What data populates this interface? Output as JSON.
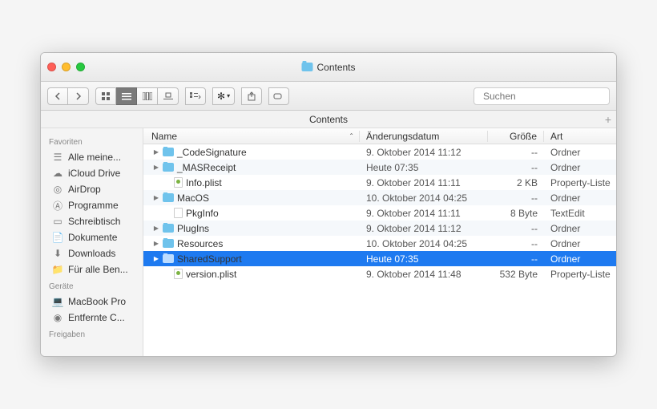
{
  "window": {
    "title": "Contents"
  },
  "toolbar": {
    "search_placeholder": "Suchen"
  },
  "pathbar": {
    "label": "Contents"
  },
  "sidebar": {
    "sections": [
      {
        "header": "Favoriten",
        "items": [
          {
            "icon": "all-files-icon",
            "label": "Alle meine..."
          },
          {
            "icon": "cloud-icon",
            "label": "iCloud Drive"
          },
          {
            "icon": "airdrop-icon",
            "label": "AirDrop"
          },
          {
            "icon": "applications-icon",
            "label": "Programme"
          },
          {
            "icon": "desktop-icon",
            "label": "Schreibtisch"
          },
          {
            "icon": "documents-icon",
            "label": "Dokumente"
          },
          {
            "icon": "downloads-icon",
            "label": "Downloads"
          },
          {
            "icon": "folder-icon",
            "label": "Für alle Ben..."
          }
        ]
      },
      {
        "header": "Geräte",
        "items": [
          {
            "icon": "laptop-icon",
            "label": "MacBook Pro"
          },
          {
            "icon": "disc-icon",
            "label": "Entfernte C..."
          }
        ]
      },
      {
        "header": "Freigaben",
        "items": []
      }
    ]
  },
  "columns": {
    "name": "Name",
    "date": "Änderungsdatum",
    "size": "Größe",
    "kind": "Art"
  },
  "files": [
    {
      "expandable": true,
      "indent": 0,
      "icon": "folder",
      "name": "_CodeSignature",
      "date": "9. Oktober 2014 11:12",
      "size": "--",
      "kind": "Ordner",
      "selected": false
    },
    {
      "expandable": true,
      "indent": 0,
      "icon": "folder",
      "name": "_MASReceipt",
      "date": "Heute 07:35",
      "size": "--",
      "kind": "Ordner",
      "selected": false
    },
    {
      "expandable": false,
      "indent": 1,
      "icon": "plist",
      "name": "Info.plist",
      "date": "9. Oktober 2014 11:11",
      "size": "2 KB",
      "kind": "Property-Liste",
      "selected": false
    },
    {
      "expandable": true,
      "indent": 0,
      "icon": "folder",
      "name": "MacOS",
      "date": "10. Oktober 2014 04:25",
      "size": "--",
      "kind": "Ordner",
      "selected": false
    },
    {
      "expandable": false,
      "indent": 1,
      "icon": "file",
      "name": "PkgInfo",
      "date": "9. Oktober 2014 11:11",
      "size": "8 Byte",
      "kind": "TextEdit",
      "selected": false
    },
    {
      "expandable": true,
      "indent": 0,
      "icon": "folder",
      "name": "PlugIns",
      "date": "9. Oktober 2014 11:12",
      "size": "--",
      "kind": "Ordner",
      "selected": false
    },
    {
      "expandable": true,
      "indent": 0,
      "icon": "folder",
      "name": "Resources",
      "date": "10. Oktober 2014 04:25",
      "size": "--",
      "kind": "Ordner",
      "selected": false
    },
    {
      "expandable": true,
      "indent": 0,
      "icon": "folder",
      "name": "SharedSupport",
      "date": "Heute 07:35",
      "size": "--",
      "kind": "Ordner",
      "selected": true
    },
    {
      "expandable": false,
      "indent": 1,
      "icon": "plist",
      "name": "version.plist",
      "date": "9. Oktober 2014 11:48",
      "size": "532 Byte",
      "kind": "Property-Liste",
      "selected": false
    }
  ]
}
